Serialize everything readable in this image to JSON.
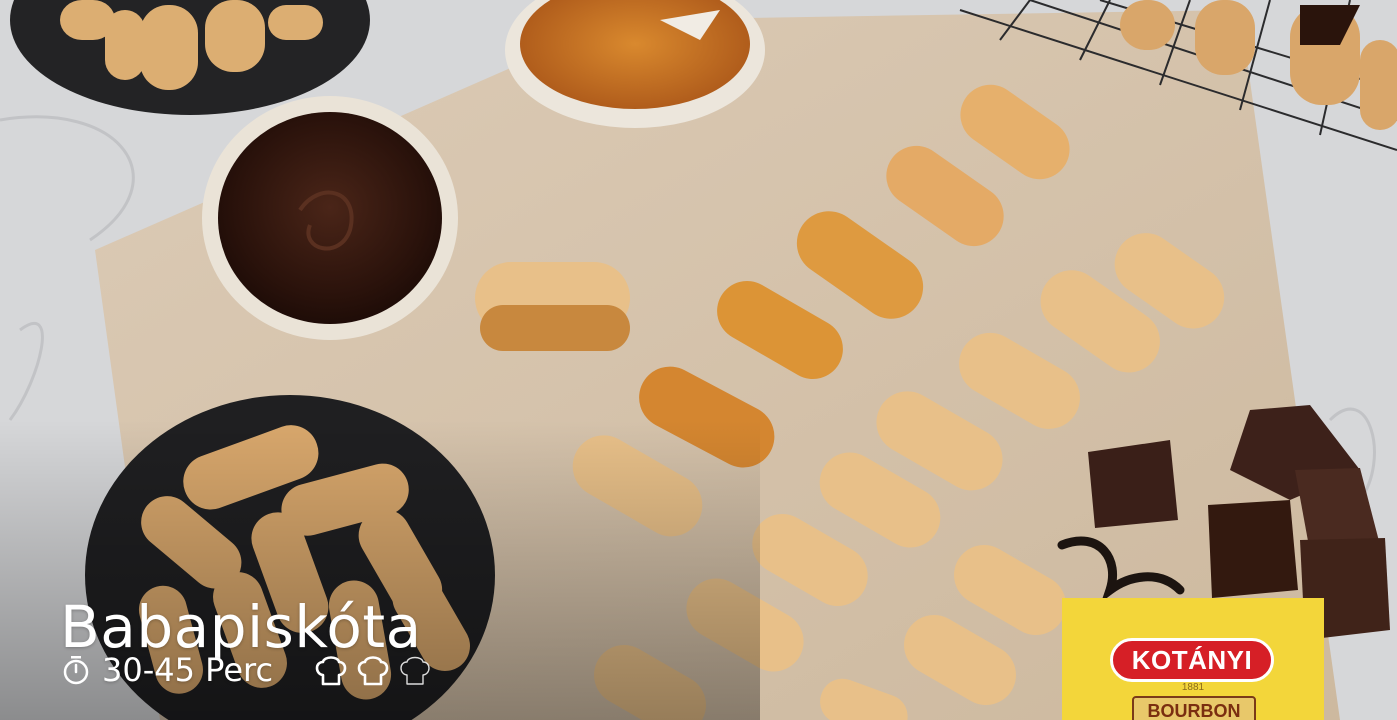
{
  "recipe": {
    "title": "Babapiskóta",
    "time": "30-45 Perc",
    "difficulty": {
      "level": 2,
      "max": 3
    }
  },
  "product": {
    "brand": "KOTÁNYI",
    "year": "1881",
    "name": "BOURBON"
  },
  "icons": {
    "timer": "stopwatch-icon",
    "difficulty": "chef-hat-icon"
  },
  "colors": {
    "text": "#ffffff",
    "brand_red": "#d61f26",
    "sachet_yellow": "#f3d63a"
  }
}
